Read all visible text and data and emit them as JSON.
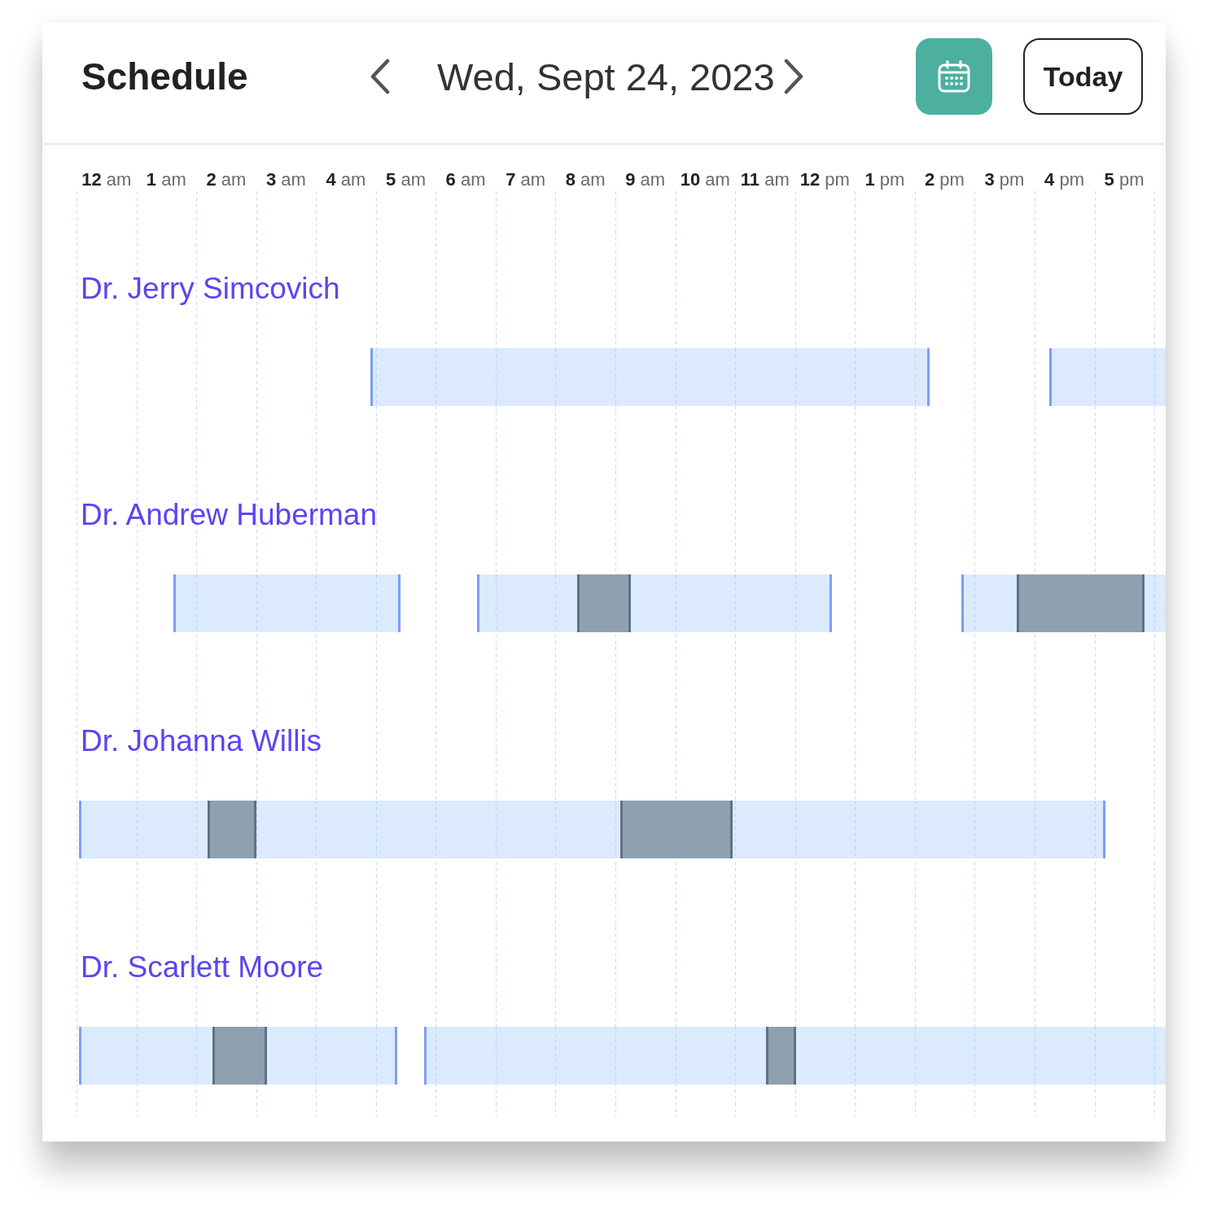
{
  "header": {
    "title": "Schedule",
    "date": "Wed, Sept 24, 2023",
    "today_button": "Today"
  },
  "hours": [
    "**12** am",
    "**1** am",
    "**2** am",
    "**3** am",
    "**4** am",
    "**5** am",
    "**6** am",
    "**7** am",
    "**8** am",
    "**9** am",
    "**10** am",
    "**11** am",
    "**12** pm",
    "**1** pm",
    "**2** pm",
    "**3** pm",
    "**4** pm",
    "**5** pm"
  ],
  "doctors": [
    {
      "name": "Dr. Jerry Simcovich",
      "shifts": [
        {
          "start": {
            "level": 0.2706
          },
          "end": {
            "level": 0.7825
          }
        },
        {
          "start": {
            "level": 0.8939
          }
        }
      ]
    },
    {
      "name": "Dr. Andrew Huberman",
      "shifts": [
        {
          "start": {
            "level": 0.0897
          },
          "end": {
            "level": 0.296
          }
        },
        {
          "start": {
            "level": 0.3692
          },
          "end": {
            "level": 0.6928
          },
          "bookings": [
            {
              "start": {
                "level": 0.4604
              },
              "end": {
                "level": 0.5082
              }
            }
          ]
        },
        {
          "start": {
            "level": 0.8132
          },
          "bookings": [
            {
              "start": {
                "level": 0.864
              },
              "end": {
                "level": 0.9791
              }
            }
          ]
        }
      ]
    },
    {
      "name": "Dr. Johanna Willis",
      "shifts": [
        {
          "start": {
            "level": 0.003
          },
          "end": {
            "level": 0.9432
          },
          "bookings": [
            {
              "start": {
                "level": 0.1211
              },
              "end": {
                "level": 0.1644
              }
            },
            {
              "start": {
                "level": 0.5007
              },
              "end": {
                "level": 0.6016
              }
            }
          ]
        }
      ]
    },
    {
      "name": "Dr. Scarlett Moore",
      "shifts": [
        {
          "start": {
            "level": 0.003
          },
          "end": {
            "level": 0.2937
          },
          "bookings": [
            {
              "start": {
                "level": 0.1256
              },
              "end": {
                "level": 0.1734
              }
            }
          ]
        },
        {
          "start": {
            "level": 0.3199
          },
          "bookings": [
            {
              "start": {
                "level": 0.6345
              },
              "end": {
                "level": 0.6599
              }
            }
          ]
        }
      ]
    }
  ]
}
